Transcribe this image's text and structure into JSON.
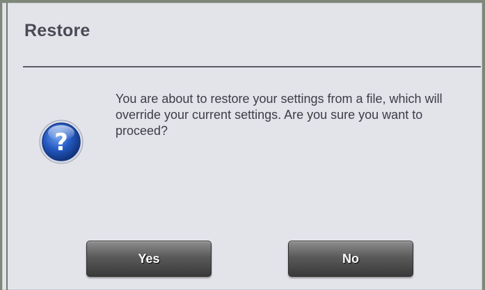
{
  "dialog": {
    "title": "Restore",
    "icon": "question-icon",
    "icon_glyph": "?",
    "message": "You are about to restore your settings from a file, which will override your current settings. Are you sure you want to proceed?",
    "buttons": {
      "yes_label": "Yes",
      "no_label": "No"
    }
  },
  "colors": {
    "background": "#e3e3ea",
    "title_text": "#4a4a55",
    "icon_blue": "#1f57b8",
    "button_dark": "#3a3a3a"
  }
}
